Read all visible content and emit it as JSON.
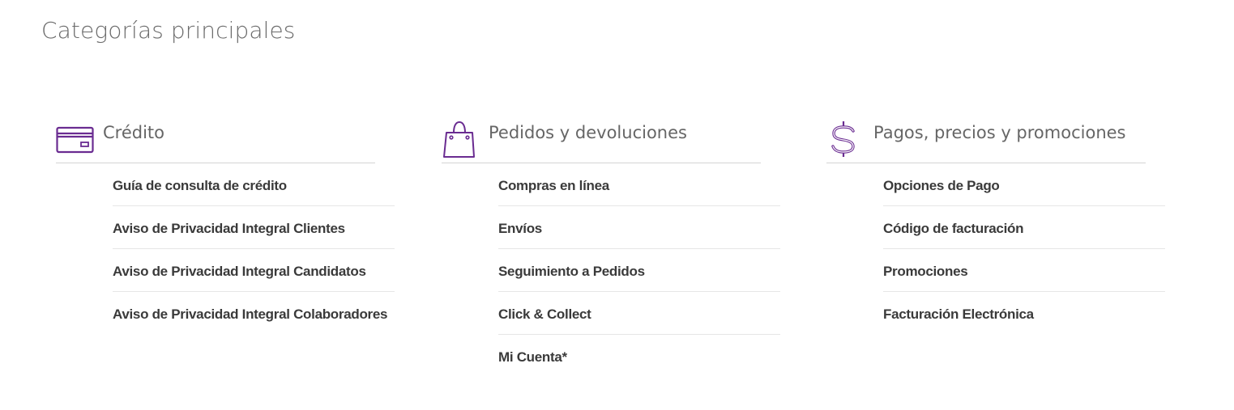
{
  "page": {
    "title": "Categorías principales"
  },
  "colors": {
    "accent": "#6a2c91",
    "divider": "#d4d4d4",
    "title": "#6b6b6b",
    "link": "#3a3a3a"
  },
  "categories": [
    {
      "title": "Crédito",
      "icon": "credit-card-icon",
      "links": [
        "Guía de consulta de crédito",
        "Aviso de Privacidad Integral Clientes",
        "Aviso de Privacidad Integral Candidatos",
        "Aviso de Privacidad Integral Colaboradores"
      ]
    },
    {
      "title": "Pedidos y devoluciones",
      "icon": "shopping-bag-icon",
      "links": [
        "Compras en línea",
        "Envíos",
        "Seguimiento a Pedidos",
        "Click & Collect",
        "Mi Cuenta*"
      ]
    },
    {
      "title": "Pagos, precios y promociones",
      "icon": "dollar-sign-icon",
      "links": [
        "Opciones de Pago",
        "Código de facturación",
        "Promociones",
        "Facturación Electrónica"
      ]
    }
  ]
}
